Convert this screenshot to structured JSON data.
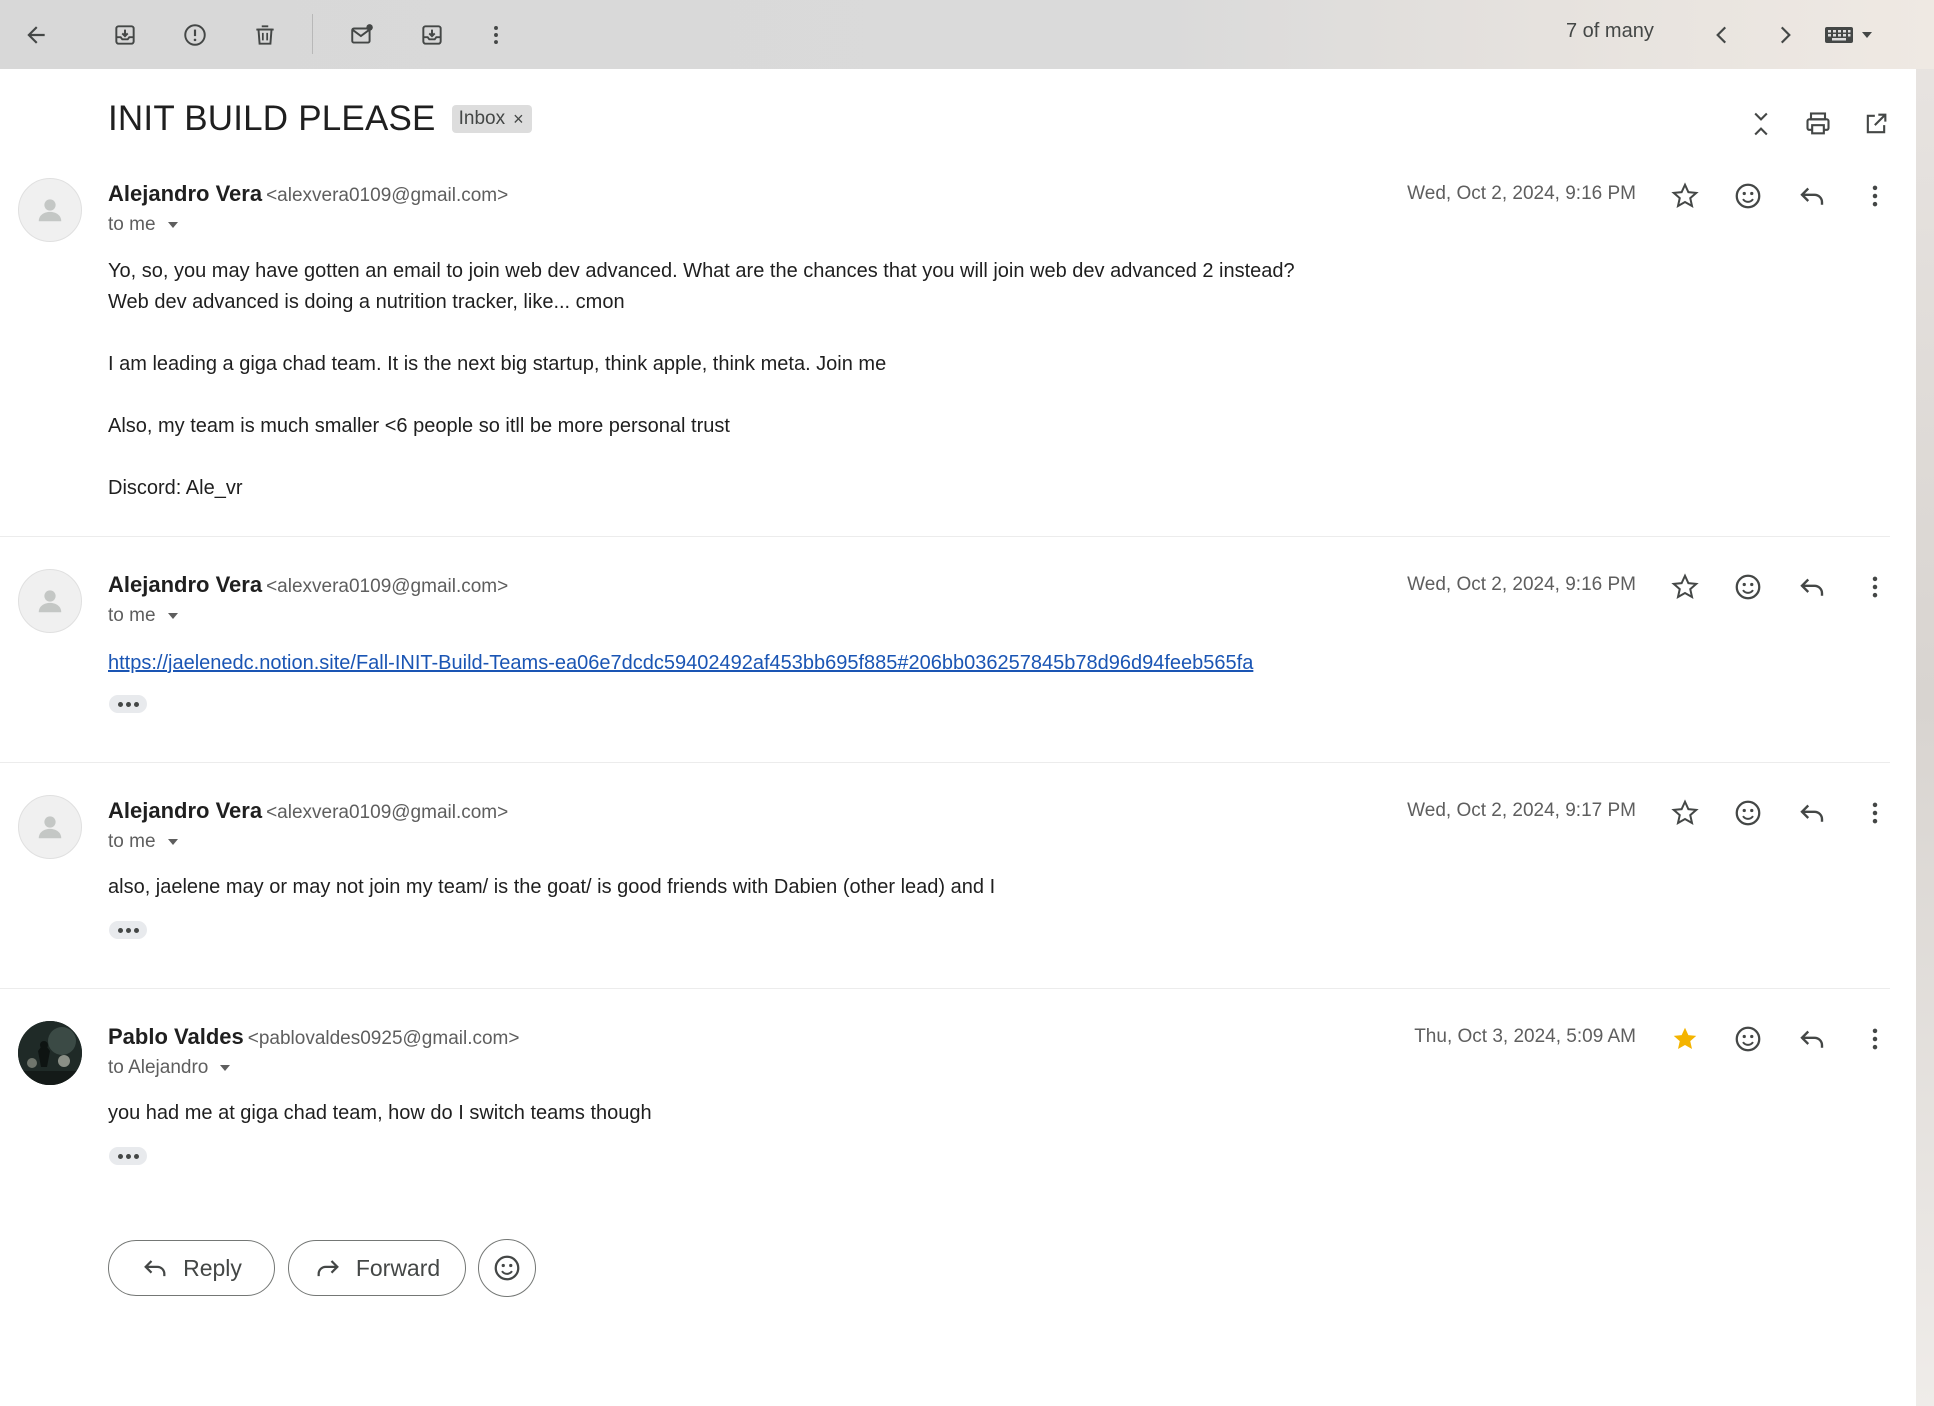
{
  "toolbar": {
    "counter": "7 of many",
    "icons": [
      "back-arrow-icon",
      "archive-icon",
      "report-spam-icon",
      "trash-icon",
      "mark-unread-icon",
      "move-to-icon",
      "more-vert-icon",
      "prev-chevron-icon",
      "next-chevron-icon",
      "keyboard-icon"
    ]
  },
  "thread": {
    "subject": "INIT BUILD PLEASE",
    "label": "Inbox",
    "label_remove": "×"
  },
  "messages": [
    {
      "sender_name": "Alejandro Vera",
      "sender_email": "<alexvera0109@gmail.com>",
      "to": "to me",
      "date": "Wed, Oct 2, 2024, 9:16 PM",
      "starred": false,
      "body": [
        "Yo, so, you may have gotten an email to join web dev advanced. What are the chances that you will join web dev advanced 2 instead?",
        "Web dev advanced is doing a nutrition tracker, like... cmon",
        "I am leading a giga chad team. It is the next big startup, think apple, think meta. Join me",
        "Also, my team is much smaller <6 people so itll be more personal trust",
        "Discord: Ale_vr"
      ]
    },
    {
      "sender_name": "Alejandro Vera",
      "sender_email": "<alexvera0109@gmail.com>",
      "to": "to me",
      "date": "Wed, Oct 2, 2024, 9:16 PM",
      "starred": false,
      "link": "https://jaelenedc.notion.site/Fall-INIT-Build-Teams-ea06e7dcdc59402492af453bb695f885#206bb036257845b78d96d94feeb565fa"
    },
    {
      "sender_name": "Alejandro Vera",
      "sender_email": "<alexvera0109@gmail.com>",
      "to": "to me",
      "date": "Wed, Oct 2, 2024, 9:17 PM",
      "starred": false,
      "body": [
        "also, jaelene may or may not join my team/ is the goat/ is good friends with Dabien (other lead) and I"
      ]
    },
    {
      "sender_name": "Pablo Valdes",
      "sender_email": "<pablovaldes0925@gmail.com>",
      "to": "to Alejandro",
      "date": "Thu, Oct 3, 2024, 5:09 AM",
      "starred": true,
      "body": [
        "you had me at giga chad team, how do I switch teams though"
      ]
    }
  ],
  "actions": {
    "reply": "Reply",
    "forward": "Forward"
  },
  "colors": {
    "star_filled": "#f4b400",
    "link": "#1a55b4",
    "icon": "#444746"
  }
}
